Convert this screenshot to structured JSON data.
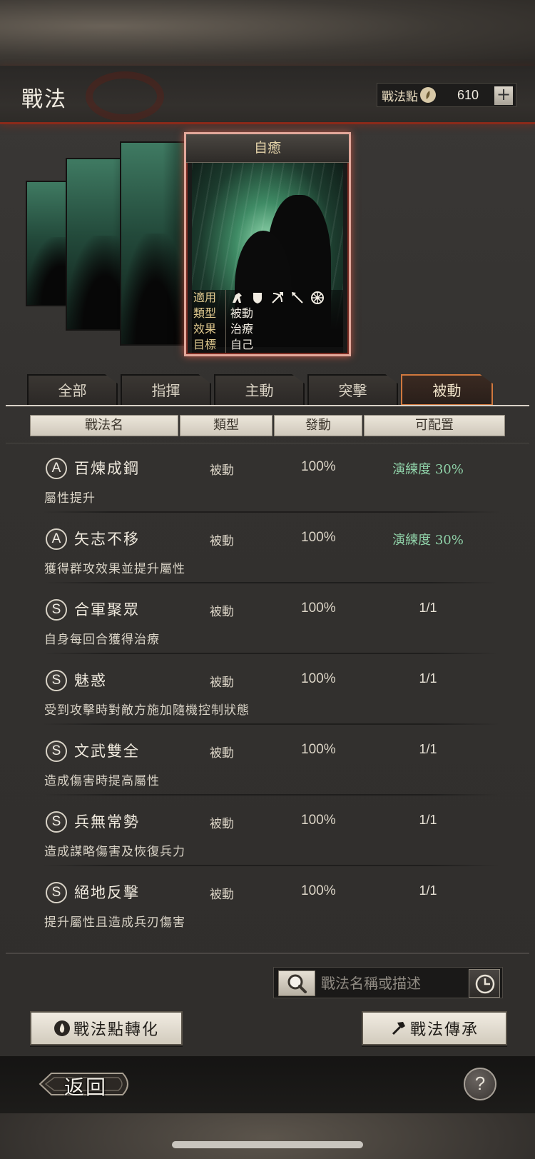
{
  "header": {
    "title": "戰法",
    "points_label": "戰法點",
    "points_value": "610",
    "add_label": "+"
  },
  "card": {
    "title": "自癒",
    "rows": [
      {
        "key": "適用",
        "value": ""
      },
      {
        "key": "類型",
        "value": "被動"
      },
      {
        "key": "效果",
        "value": "治療"
      },
      {
        "key": "目標",
        "value": "自己"
      }
    ],
    "troop_icons": [
      "cavalry-icon",
      "shield-icon",
      "archer-icon",
      "spear-icon",
      "siege-icon"
    ]
  },
  "tabs": [
    {
      "label": "全部",
      "active": false
    },
    {
      "label": "指揮",
      "active": false
    },
    {
      "label": "主動",
      "active": false
    },
    {
      "label": "突擊",
      "active": false
    },
    {
      "label": "被動",
      "active": true
    }
  ],
  "table": {
    "headers": [
      "戰法名",
      "類型",
      "發動",
      "可配置"
    ],
    "rows": [
      {
        "grade": "A",
        "name": "百煉成鋼",
        "type": "被動",
        "rate": "100%",
        "avail": "演練度 30%",
        "green": true,
        "desc": "屬性提升"
      },
      {
        "grade": "A",
        "name": "矢志不移",
        "type": "被動",
        "rate": "100%",
        "avail": "演練度 30%",
        "green": true,
        "desc": "獲得群攻效果並提升屬性"
      },
      {
        "grade": "S",
        "name": "合軍聚眾",
        "type": "被動",
        "rate": "100%",
        "avail": "1/1",
        "green": false,
        "desc": "自身每回合獲得治療"
      },
      {
        "grade": "S",
        "name": "魅惑",
        "type": "被動",
        "rate": "100%",
        "avail": "1/1",
        "green": false,
        "desc": "受到攻擊時對敵方施加隨機控制狀態"
      },
      {
        "grade": "S",
        "name": "文武雙全",
        "type": "被動",
        "rate": "100%",
        "avail": "1/1",
        "green": false,
        "desc": "造成傷害時提高屬性"
      },
      {
        "grade": "S",
        "name": "兵無常勢",
        "type": "被動",
        "rate": "100%",
        "avail": "1/1",
        "green": false,
        "desc": "造成謀略傷害及恢復兵力"
      },
      {
        "grade": "S",
        "name": "絕地反擊",
        "type": "被動",
        "rate": "100%",
        "avail": "1/1",
        "green": false,
        "desc": "提升屬性且造成兵刃傷害"
      }
    ]
  },
  "search": {
    "placeholder": "戰法名稱或描述"
  },
  "buttons": {
    "convert_label": "戰法點轉化",
    "inherit_label": "戰法傳承"
  },
  "footer": {
    "back_label": "返回",
    "help_label": "?"
  },
  "colors": {
    "accent_red": "#8a2a1a",
    "active_tab_border": "#d0783e",
    "green_text": "#8fd1a8"
  }
}
